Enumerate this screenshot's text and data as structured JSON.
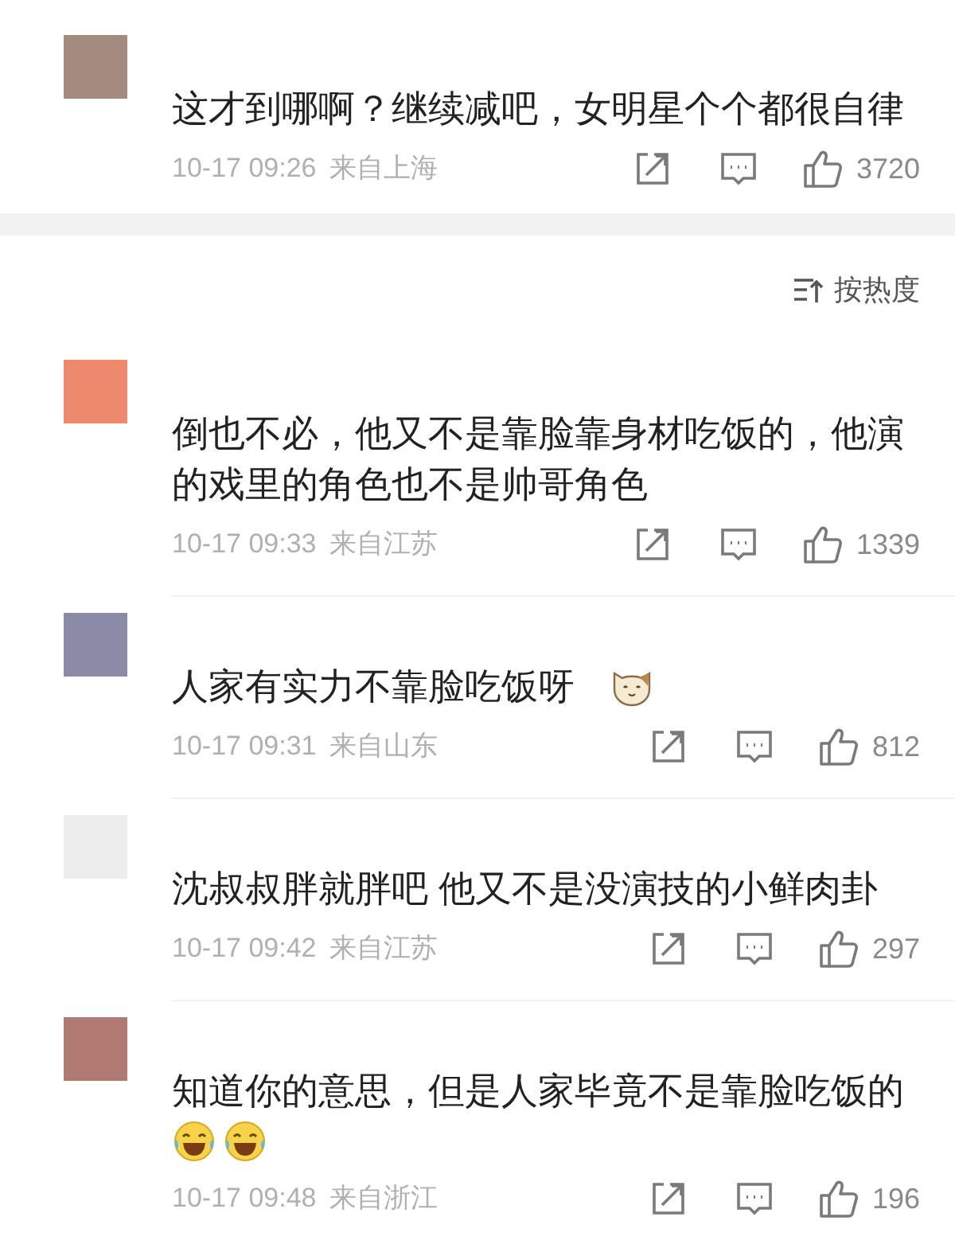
{
  "top_comment": {
    "color": "#a58b7d",
    "text": "这才到哪啊？继续减吧，女明星个个都很自律",
    "time": "10-17 09:26",
    "location": "来自上海",
    "likes": "3720"
  },
  "sort": {
    "label": "按热度"
  },
  "comments": [
    {
      "color": "#ec8a6b",
      "text": "倒也不必，他又不是靠脸靠身材吃饭的，他演的戏里的角色也不是帅哥角色",
      "time": "10-17 09:33",
      "location": "来自江苏",
      "likes": "1339"
    },
    {
      "color": "#8a8aa5",
      "text": "人家有实力不靠脸吃饭呀",
      "emojis": [
        {
          "kind": "cat"
        }
      ],
      "time": "10-17 09:31",
      "location": "来自山东",
      "likes": "812"
    },
    {
      "color": "#ededed",
      "text": "沈叔叔胖就胖吧 他又不是没演技的小鲜肉卦",
      "time": "10-17 09:42",
      "location": "来自江苏",
      "likes": "297"
    },
    {
      "color": "#b07a72",
      "text": "知道你的意思，但是人家毕竟不是靠脸吃饭的",
      "emojis": [
        {
          "kind": "laugh-cry"
        },
        {
          "kind": "laugh-cry"
        }
      ],
      "time": "10-17 09:48",
      "location": "来自浙江",
      "likes": "196"
    }
  ]
}
